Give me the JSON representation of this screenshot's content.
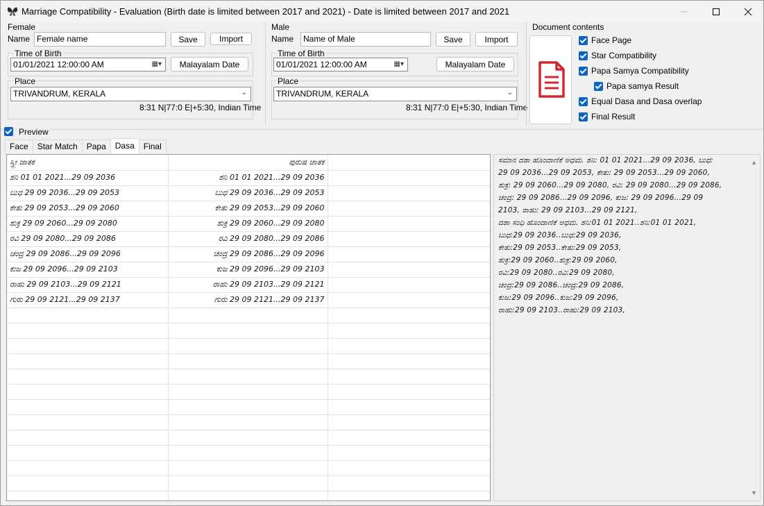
{
  "window": {
    "title": "Marriage  Compatibility - Evaluation  (Birth date is limited between 2017 and 2021)  - Date is limited between 2017 and 2021"
  },
  "female": {
    "group_label": "Female",
    "name_label": "Name",
    "name_value": "Female name",
    "save_label": "Save",
    "import_label": "Import",
    "tob_label": "Time of Birth",
    "tob_value": "01/01/2021  12:00:00 AM",
    "malayalam_date_label": "Malayalam Date",
    "place_label": "Place",
    "place_value": "TRIVANDRUM, KERALA",
    "coords": "8:31 N|77:0 E|+5:30, Indian Time"
  },
  "male": {
    "group_label": "Male",
    "name_label": "Name",
    "name_value": "Name of Male",
    "save_label": "Save",
    "import_label": "Import",
    "tob_label": "Time of Birth",
    "tob_value": "01/01/2021  12:00:00 AM",
    "malayalam_date_label": "Malayalam Date",
    "place_label": "Place",
    "place_value": "TRIVANDRUM, KERALA",
    "coords": "8:31 N|77:0 E|+5:30, Indian Time"
  },
  "document_contents": {
    "label": "Document contents",
    "items": [
      {
        "label": "Face Page",
        "checked": true
      },
      {
        "label": "Star Compatibility",
        "checked": true
      },
      {
        "label": "Papa Samya Compatibility",
        "checked": true
      },
      {
        "label": "Papa samya Result",
        "checked": true
      },
      {
        "label": "Equal Dasa and Dasa overlap",
        "checked": true
      },
      {
        "label": "Final Result",
        "checked": true
      }
    ]
  },
  "preview": {
    "label": "Preview",
    "checked": true
  },
  "tabs": [
    "Face",
    "Star Match",
    "Papa",
    "Dasa",
    "Final"
  ],
  "active_tab": "Dasa",
  "grid": {
    "headers": [
      "ಸ್ತ್ರೀ ಜಾತಕ",
      "ಪುರುಷ ಜಾತಕ",
      ""
    ],
    "rows": [
      [
        "ಶನಿ 01   01   2021...29   09   2036",
        "ಶನಿ 01   01   2021...29   09   2036"
      ],
      [
        "ಬುಧ 29   09   2036...29   09   2053",
        "ಬುಧ 29   09   2036...29   09   2053"
      ],
      [
        "ಕೇತು 29   09   2053...29   09   2060",
        "ಕೇತು 29   09   2053...29   09   2060"
      ],
      [
        "ಶುಕ್ರ 29   09   2060...29   09   2080",
        "ಶುಕ್ರ 29   09   2060...29   09   2080"
      ],
      [
        "ರವಿ 29   09   2080...29   09   2086",
        "ರವಿ 29   09   2080...29   09   2086"
      ],
      [
        "ಚಂದ್ರ 29   09   2086...29   09   2096",
        "ಚಂದ್ರ 29   09   2086...29   09   2096"
      ],
      [
        "ಕುಜ 29   09   2096...29   09   2103",
        "ಕುಜ 29   09   2096...29   09   2103"
      ],
      [
        "ರಾಹು 29   09   2103...29   09   2121",
        "ರಾಹು 29   09   2103...29   09   2121"
      ],
      [
        "ಗುರು 29   09   2121...29   09   2137",
        "ಗುರು 29   09   2121...29   09   2137"
      ]
    ]
  },
  "report": {
    "lines": [
      "ಸಮಾನ ದಶಾ ಹೊಂದಾಣಿಕೆ ಅಧಮ. ಶನಿ: 01   01   2021...29   09   2036, ಬುಧ:",
      "29   09   2036...29   09   2053, ಕೇತು: 29   09   2053...29   09   2060,",
      "ಶುಕ್ರ: 29   09   2060...29   09   2080, ರವಿ: 29   09   2080...29   09   2086,",
      "ಚಂದ್ರ: 29   09   2086...29   09   2096, ಕುಜ: 29   09   2096...29   09",
      "2103, ರಾಹು: 29   09   2103...29   09   2121,",
      "ದಶಾ ಸಂಧಿ ಹೊಂದಾಣಿಕೆ ಅಧಮ. ಶನಿ:01   01   2021..ಶನಿ:01   01   2021,",
      "ಬುಧ:29   09   2036..ಬುಧ:29   09   2036,",
      "ಕೇತು:29   09   2053..ಕೇತು:29   09   2053,",
      "ಶುಕ್ರ:29   09   2060..ಶುಕ್ರ:29   09   2060,",
      "ರವಿ:29   09   2080..ರವಿ:29   09   2080,",
      "ಚಂದ್ರ:29   09   2086..ಚಂದ್ರ:29   09   2086,",
      "ಕುಜ:29   09   2096..ಕುಜ:29   09   2096,",
      "ರಾಹು:29   09   2103..ರಾಹು:29   09   2103,"
    ]
  },
  "icons": {
    "app": "butterfly-icon",
    "document": "document-icon",
    "accent": "#0c63c4",
    "doc_red": "#d0282e"
  }
}
